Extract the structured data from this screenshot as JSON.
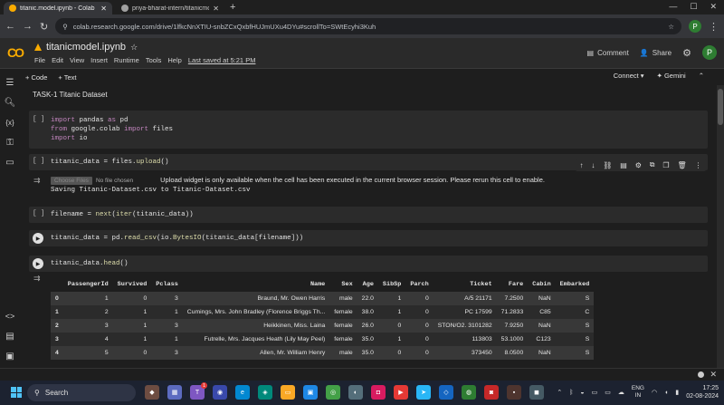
{
  "browser": {
    "tabs": [
      {
        "title": "titanic.model.ipynb - Colab",
        "active": true
      },
      {
        "title": "priya-bharat-intern/titanicmod...",
        "active": false
      }
    ],
    "url": "colab.research.google.com/drive/1lfkcNnXTIU-snbZCxQxbfHUJmUXu4DYu#scrollTo=SWtEcyhi3Kuh",
    "profile_initial": "P"
  },
  "colab": {
    "logo_text": "CO",
    "notebook_title": "titanicmodel.ipynb",
    "menu": [
      "File",
      "Edit",
      "View",
      "Insert",
      "Runtime",
      "Tools",
      "Help"
    ],
    "last_saved": "Last saved at 5:21 PM",
    "comment_label": "Comment",
    "share_label": "Share",
    "profile_initial": "P",
    "add_code_label": "+ Code",
    "add_text_label": "+ Text",
    "connect_label": "Connect",
    "gemini_label": "Gemini"
  },
  "notebook": {
    "heading": "TASK-1 Titanic Dataset",
    "run_empty": "[ ]",
    "upload_button": "Choose Files",
    "no_file": "No file chosen",
    "upload_message": "Upload widget is only available when the cell has been executed in the current browser session. Please rerun this cell to enable.",
    "upload_saved": "Saving Titanic-Dataset.csv to Titanic-Dataset.csv"
  },
  "table": {
    "columns": [
      "",
      "PassengerId",
      "Survived",
      "Pclass",
      "Name",
      "Sex",
      "Age",
      "SibSp",
      "Parch",
      "Ticket",
      "Fare",
      "Cabin",
      "Embarked"
    ],
    "rows": [
      [
        "0",
        "1",
        "0",
        "3",
        "Braund, Mr. Owen Harris",
        "male",
        "22.0",
        "1",
        "0",
        "A/5 21171",
        "7.2500",
        "NaN",
        "S"
      ],
      [
        "1",
        "2",
        "1",
        "1",
        "Cumings, Mrs. John Bradley (Florence Briggs Th...",
        "female",
        "38.0",
        "1",
        "0",
        "PC 17599",
        "71.2833",
        "C85",
        "C"
      ],
      [
        "2",
        "3",
        "1",
        "3",
        "Heikkinen, Miss. Laina",
        "female",
        "26.0",
        "0",
        "0",
        "STON/O2. 3101282",
        "7.9250",
        "NaN",
        "S"
      ],
      [
        "3",
        "4",
        "1",
        "1",
        "Futrelle, Mrs. Jacques Heath (Lily May Peel)",
        "female",
        "35.0",
        "1",
        "0",
        "113803",
        "53.1000",
        "C123",
        "S"
      ],
      [
        "4",
        "5",
        "0",
        "3",
        "Allen, Mr. William Henry",
        "male",
        "35.0",
        "0",
        "0",
        "373450",
        "8.0500",
        "NaN",
        "S"
      ]
    ]
  },
  "taskbar": {
    "search_label": "Search",
    "language": "ENG",
    "region": "IN",
    "time": "17:25",
    "date": "02-08-2024",
    "notification_count": "1"
  }
}
